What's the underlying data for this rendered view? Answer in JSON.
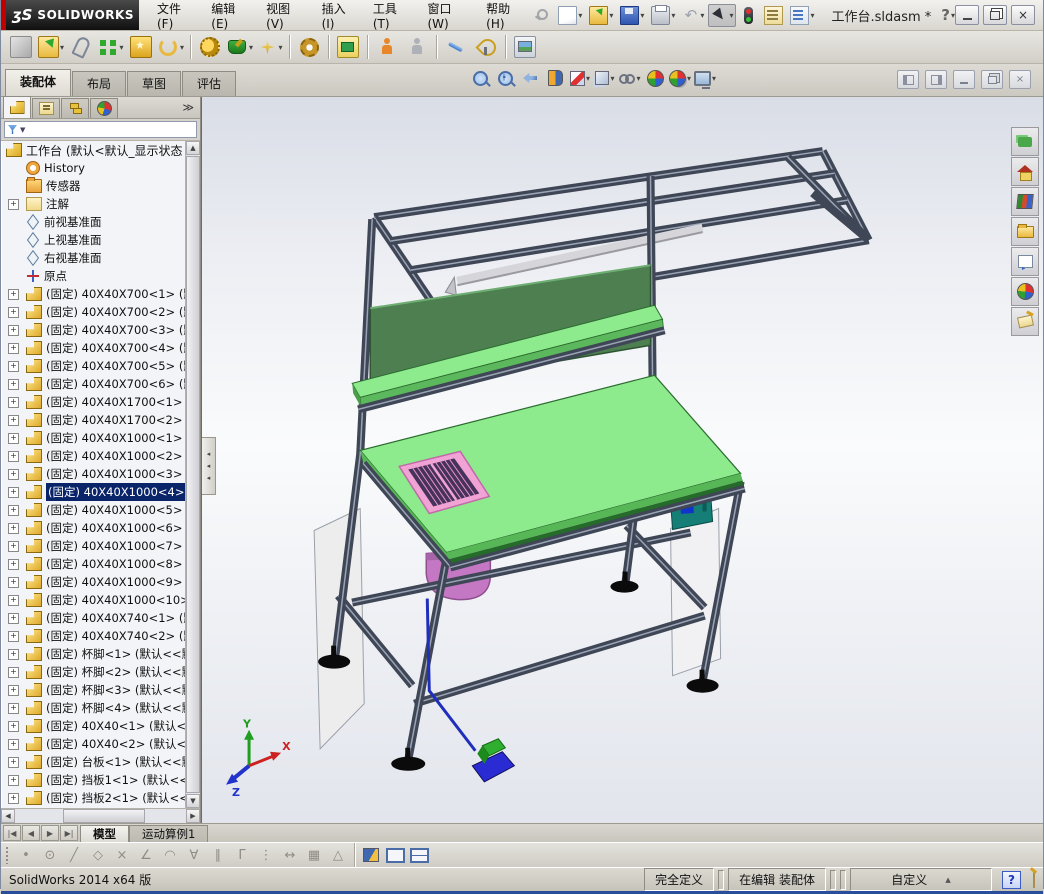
{
  "window": {
    "brand_mark": "ʒS",
    "brand": "SOLIDWORKS",
    "title": "工作台.sldasm *",
    "help_glyph": "?",
    "close_glyph": "×",
    "menus": [
      "文件(F)",
      "编辑(E)",
      "视图(V)",
      "插入(I)",
      "工具(T)",
      "窗口(W)",
      "帮助(H)"
    ]
  },
  "qat": [
    {
      "name": "new-document",
      "icon": "ic-new",
      "dropdown": true
    },
    {
      "name": "open",
      "icon": "ic-open",
      "dropdown": true
    },
    {
      "name": "save",
      "icon": "ic-save",
      "dropdown": true
    },
    {
      "name": "print",
      "icon": "ic-print",
      "dropdown": true
    },
    {
      "name": "undo",
      "icon": "ic-undo",
      "glyph": "↶",
      "dropdown": true
    },
    {
      "name": "select-cursor",
      "icon": "ic-cursor",
      "dropdown": true,
      "pressed": true
    },
    {
      "name": "rebuild",
      "icon": "ic-rebuild",
      "dropdown": false
    },
    {
      "name": "file-properties",
      "icon": "ic-props",
      "dropdown": false
    },
    {
      "name": "options",
      "icon": "ic-list",
      "dropdown": true
    }
  ],
  "command_tabs": [
    {
      "label": "装配体",
      "active": true
    },
    {
      "label": "布局",
      "active": false
    },
    {
      "label": "草图",
      "active": false
    },
    {
      "label": "评估",
      "active": false
    }
  ],
  "assembly_toolbar": [
    {
      "name": "insert-components",
      "style": "g-cube-gray",
      "dropdown": false
    },
    {
      "name": "open-component",
      "style": "g-open-green",
      "dropdown": true
    },
    {
      "name": "mate",
      "style": "g-clip",
      "dropdown": false
    },
    {
      "name": "linear-component-pattern",
      "style": "g-pattern",
      "dropdown": true
    },
    {
      "name": "smart-fasteners",
      "style": "g-fast",
      "dropdown": false
    },
    {
      "name": "move-component",
      "style": "g-move",
      "dropdown": true,
      "sep_after": true
    },
    {
      "name": "assembly-features",
      "style": "g-gears",
      "dropdown": false
    },
    {
      "name": "reference-geometry",
      "style": "g-anvil",
      "dropdown": true
    },
    {
      "name": "new-sketch",
      "style": "g-spark",
      "dropdown": true,
      "sep_after": true
    },
    {
      "name": "bill-of-materials",
      "style": "g-gearplus",
      "dropdown": false,
      "sep_after": true
    },
    {
      "name": "exploded-view",
      "style": "g-winbox",
      "dropdown": false,
      "sep_after": true
    },
    {
      "name": "interference-detection",
      "style": "g-figure",
      "dropdown": false
    },
    {
      "name": "clearance-verification",
      "style": "g-figure-gray",
      "dropdown": false,
      "sep_after": true
    },
    {
      "name": "explode-line-sketch",
      "style": "g-bluearrow",
      "dropdown": false
    },
    {
      "name": "assembly-xpert",
      "style": "g-radar",
      "dropdown": false,
      "sep_after": true
    },
    {
      "name": "take-snapshot",
      "style": "g-photo",
      "dropdown": false
    }
  ],
  "headsup": [
    {
      "name": "zoom-to-fit",
      "kind": "mag",
      "dropdown": false
    },
    {
      "name": "zoom-to-area",
      "kind": "mag-plus",
      "dropdown": false
    },
    {
      "name": "previous-view",
      "kind": "prevview",
      "dropdown": false
    },
    {
      "name": "section-view",
      "kind": "section",
      "dropdown": false
    },
    {
      "name": "view-orientation",
      "kind": "vcube",
      "dropdown": true
    },
    {
      "name": "display-style",
      "kind": "dcube",
      "dropdown": true
    },
    {
      "name": "hide-show-items",
      "kind": "glasses",
      "dropdown": true
    },
    {
      "name": "edit-appearance",
      "kind": "ball",
      "dropdown": false
    },
    {
      "name": "apply-scene",
      "kind": "ball-scene",
      "dropdown": true
    },
    {
      "name": "view-settings",
      "kind": "monitor",
      "dropdown": true
    }
  ],
  "doc_window_buttons": [
    {
      "name": "tile-left",
      "kind": "pane-l"
    },
    {
      "name": "tile-right",
      "kind": "pane-r"
    },
    {
      "name": "minimize-doc",
      "kind": "min"
    },
    {
      "name": "restore-doc",
      "kind": "rest"
    },
    {
      "name": "close-doc",
      "kind": "close",
      "glyph": "×"
    }
  ],
  "panel": {
    "tabs": [
      "feature-manager",
      "property-manager",
      "configuration-manager",
      "display-manager"
    ],
    "overflow_glyph": "≫",
    "filter_arrow": "▼"
  },
  "tree": {
    "items": [
      {
        "label": "工作台 (默认<默认_显示状态",
        "icon": "assembly",
        "root": true,
        "plus": false,
        "selected": false
      },
      {
        "label": "History",
        "icon": "history",
        "plus": false,
        "selected": false
      },
      {
        "label": "传感器",
        "icon": "sensors",
        "plus": false,
        "selected": false
      },
      {
        "label": "注解",
        "icon": "annot",
        "plus": true,
        "selected": false
      },
      {
        "label": "前视基准面",
        "icon": "plane",
        "plus": false,
        "selected": false
      },
      {
        "label": "上视基准面",
        "icon": "plane",
        "plus": false,
        "selected": false
      },
      {
        "label": "右视基准面",
        "icon": "plane",
        "plus": false,
        "selected": false
      },
      {
        "label": "原点",
        "icon": "origin",
        "plus": false,
        "selected": false
      },
      {
        "label": "(固定) 40X40X700<1> (默认",
        "icon": "part",
        "plus": true,
        "selected": false
      },
      {
        "label": "(固定) 40X40X700<2> (默认",
        "icon": "part",
        "plus": true,
        "selected": false
      },
      {
        "label": "(固定) 40X40X700<3> (默认",
        "icon": "part",
        "plus": true,
        "selected": false
      },
      {
        "label": "(固定) 40X40X700<4> (默认",
        "icon": "part",
        "plus": true,
        "selected": false
      },
      {
        "label": "(固定) 40X40X700<5> (默认",
        "icon": "part",
        "plus": true,
        "selected": false
      },
      {
        "label": "(固定) 40X40X700<6> (默认",
        "icon": "part",
        "plus": true,
        "selected": false
      },
      {
        "label": "(固定) 40X40X1700<1> (默",
        "icon": "part",
        "plus": true,
        "selected": false
      },
      {
        "label": "(固定) 40X40X1700<2> (默",
        "icon": "part",
        "plus": true,
        "selected": false
      },
      {
        "label": "(固定) 40X40X1000<1> (默",
        "icon": "part",
        "plus": true,
        "selected": false
      },
      {
        "label": "(固定) 40X40X1000<2> (默",
        "icon": "part",
        "plus": true,
        "selected": false
      },
      {
        "label": "(固定) 40X40X1000<3> (默",
        "icon": "part",
        "plus": true,
        "selected": false
      },
      {
        "label": "(固定) 40X40X1000<4> (默",
        "icon": "part",
        "plus": true,
        "selected": true
      },
      {
        "label": "(固定) 40X40X1000<5> (默",
        "icon": "part",
        "plus": true,
        "selected": false
      },
      {
        "label": "(固定) 40X40X1000<6> (默",
        "icon": "part",
        "plus": true,
        "selected": false
      },
      {
        "label": "(固定) 40X40X1000<7> (默",
        "icon": "part",
        "plus": true,
        "selected": false
      },
      {
        "label": "(固定) 40X40X1000<8> (默",
        "icon": "part",
        "plus": true,
        "selected": false
      },
      {
        "label": "(固定) 40X40X1000<9> (默",
        "icon": "part",
        "plus": true,
        "selected": false
      },
      {
        "label": "(固定) 40X40X1000<10> (默",
        "icon": "part",
        "plus": true,
        "selected": false
      },
      {
        "label": "(固定) 40X40X740<1> (默认",
        "icon": "part",
        "plus": true,
        "selected": false
      },
      {
        "label": "(固定) 40X40X740<2> (默认",
        "icon": "part",
        "plus": true,
        "selected": false
      },
      {
        "label": "(固定) 杯脚<1> (默认<<默",
        "icon": "part",
        "plus": true,
        "selected": false
      },
      {
        "label": "(固定) 杯脚<2> (默认<<默",
        "icon": "part",
        "plus": true,
        "selected": false
      },
      {
        "label": "(固定) 杯脚<3> (默认<<默",
        "icon": "part",
        "plus": true,
        "selected": false
      },
      {
        "label": "(固定) 杯脚<4> (默认<<默",
        "icon": "part",
        "plus": true,
        "selected": false
      },
      {
        "label": "(固定) 40X40<1> (默认<<",
        "icon": "part",
        "plus": true,
        "selected": false
      },
      {
        "label": "(固定) 40X40<2> (默认<<",
        "icon": "part",
        "plus": true,
        "selected": false
      },
      {
        "label": "(固定) 台板<1> (默认<<默",
        "icon": "part",
        "plus": true,
        "selected": false
      },
      {
        "label": "(固定) 挡板1<1> (默认<<",
        "icon": "part",
        "plus": true,
        "selected": false
      },
      {
        "label": "(固定) 挡板2<1> (默认<<",
        "icon": "part",
        "plus": true,
        "selected": false
      }
    ]
  },
  "glyphs": {
    "plus": "+",
    "up": "▲",
    "down": "▼",
    "left": "◀",
    "right": "▶",
    "splitter": "◂"
  },
  "bottom_tabs": {
    "nav": [
      "|◀",
      "◀",
      "▶",
      "▶|"
    ],
    "tabs": [
      {
        "label": "模型",
        "active": true
      },
      {
        "label": "运动算例1",
        "active": false
      }
    ]
  },
  "sketch_toolbar": [
    {
      "name": "point",
      "glyph": "•"
    },
    {
      "name": "circle",
      "glyph": "⊙"
    },
    {
      "name": "line",
      "glyph": "╱"
    },
    {
      "name": "polygon",
      "glyph": "◇"
    },
    {
      "name": "trim-entities",
      "glyph": "×"
    },
    {
      "name": "sketch-fillet",
      "glyph": "∠"
    },
    {
      "name": "arc",
      "glyph": "◠"
    },
    {
      "name": "mirror-entities",
      "glyph": "∀"
    },
    {
      "name": "offset-entities",
      "glyph": "∥"
    },
    {
      "name": "corner-rectangle",
      "glyph": "Γ"
    },
    {
      "name": "construction-line",
      "glyph": "⋮"
    },
    {
      "name": "smart-dimension",
      "glyph": "↔"
    },
    {
      "name": "grid",
      "glyph": "▦"
    },
    {
      "name": "angle",
      "glyph": "△"
    }
  ],
  "status": {
    "left_text": "SolidWorks 2014 x64 版",
    "fully_defined": "完全定义",
    "editing": "在编辑 装配体",
    "custom": "自定义",
    "custom_arrow": "▲",
    "help_glyph": "?"
  },
  "task_pane": [
    {
      "name": "solidworks-forum",
      "kind": "tp-chat"
    },
    {
      "name": "solidworks-resources",
      "kind": "tp-home"
    },
    {
      "name": "design-library",
      "kind": "tp-books"
    },
    {
      "name": "file-explorer",
      "kind": "tp-folder"
    },
    {
      "name": "view-palette",
      "kind": "tp-palette"
    },
    {
      "name": "appearances-scenes",
      "kind": "tp-ball"
    },
    {
      "name": "custom-properties",
      "kind": "tp-tag"
    }
  ],
  "triad": {
    "x": "X",
    "y": "Y",
    "z": "Z",
    "x_color": "#cc2222",
    "y_color": "#1f9e1f",
    "z_color": "#2233cc"
  },
  "model_colors": {
    "frame_steel": "#3f4655",
    "worktop_green": "#8deb8d",
    "back_panel_green": "#4d7f50",
    "rim_dark_green": "#256b29",
    "vent_pink": "#f2a3d6",
    "bowl_purple": "#c478c4",
    "side_panel_white": "#ededee",
    "pedal_blue": "#2b2bd4",
    "pedal_green": "#2fae2f",
    "box_teal": "#157f77",
    "feet_black": "#0b0b0b"
  }
}
